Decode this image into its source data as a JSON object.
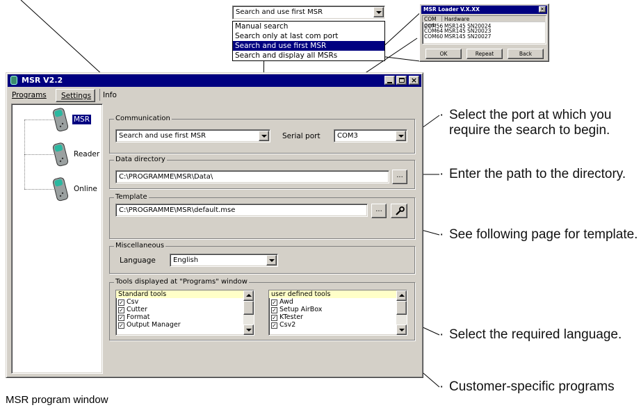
{
  "window": {
    "title": "MSR V2.2",
    "menu": [
      "Programs",
      "Settings",
      "Info"
    ],
    "tree": [
      "MSR",
      "Reader",
      "Online"
    ]
  },
  "communication": {
    "title": "Communication",
    "search_mode": "Search and use first MSR",
    "serial_label": "Serial port",
    "serial_port": "COM3"
  },
  "data_directory": {
    "title": "Data directory",
    "path": "C:\\PROGRAMME\\MSR\\Data\\",
    "browse": "..."
  },
  "template": {
    "title": "Template",
    "path": "C:\\PROGRAMME\\MSR\\default.mse",
    "browse": "...",
    "tool_icon": "wrench-icon"
  },
  "misc": {
    "title": "Miscellaneous",
    "language_label": "Language",
    "language": "English"
  },
  "tools": {
    "title": "Tools displayed at \"Programs\" window",
    "standard_header": "Standard tools",
    "standard": [
      "Csv",
      "Cutter",
      "Format",
      "Output Manager"
    ],
    "user_header": "user defined tools",
    "user": [
      "Awd",
      "Setup AirBox",
      "KTester",
      "Csv2"
    ]
  },
  "search_dropdown": {
    "selected": "Search and use first MSR",
    "options": [
      "Manual search",
      "Search only at last com port",
      "Search and use first MSR",
      "Search and display all MSRs"
    ],
    "highlighted_index": 2
  },
  "loader": {
    "title": "MSR Loader V.X.XX",
    "columns": [
      "COM port",
      "Hardware"
    ],
    "rows": [
      [
        "COM56",
        "MSR145 SN20024"
      ],
      [
        "COM64",
        "MSR145 SN20023"
      ],
      [
        "COM60",
        "MSR145 SN20027"
      ]
    ],
    "buttons": [
      "OK",
      "Repeat",
      "Back"
    ]
  },
  "callouts": [
    "Select the port at which you require the search to begin.",
    "Enter the path to the directory.",
    "See following page for template.",
    "Select the required language.",
    "Customer-specific programs"
  ],
  "caption": "MSR program window",
  "colors": {
    "titlebar": "#000080",
    "face": "#d4d0c8",
    "highlight": "#000080",
    "list_header": "#ffffc8"
  }
}
